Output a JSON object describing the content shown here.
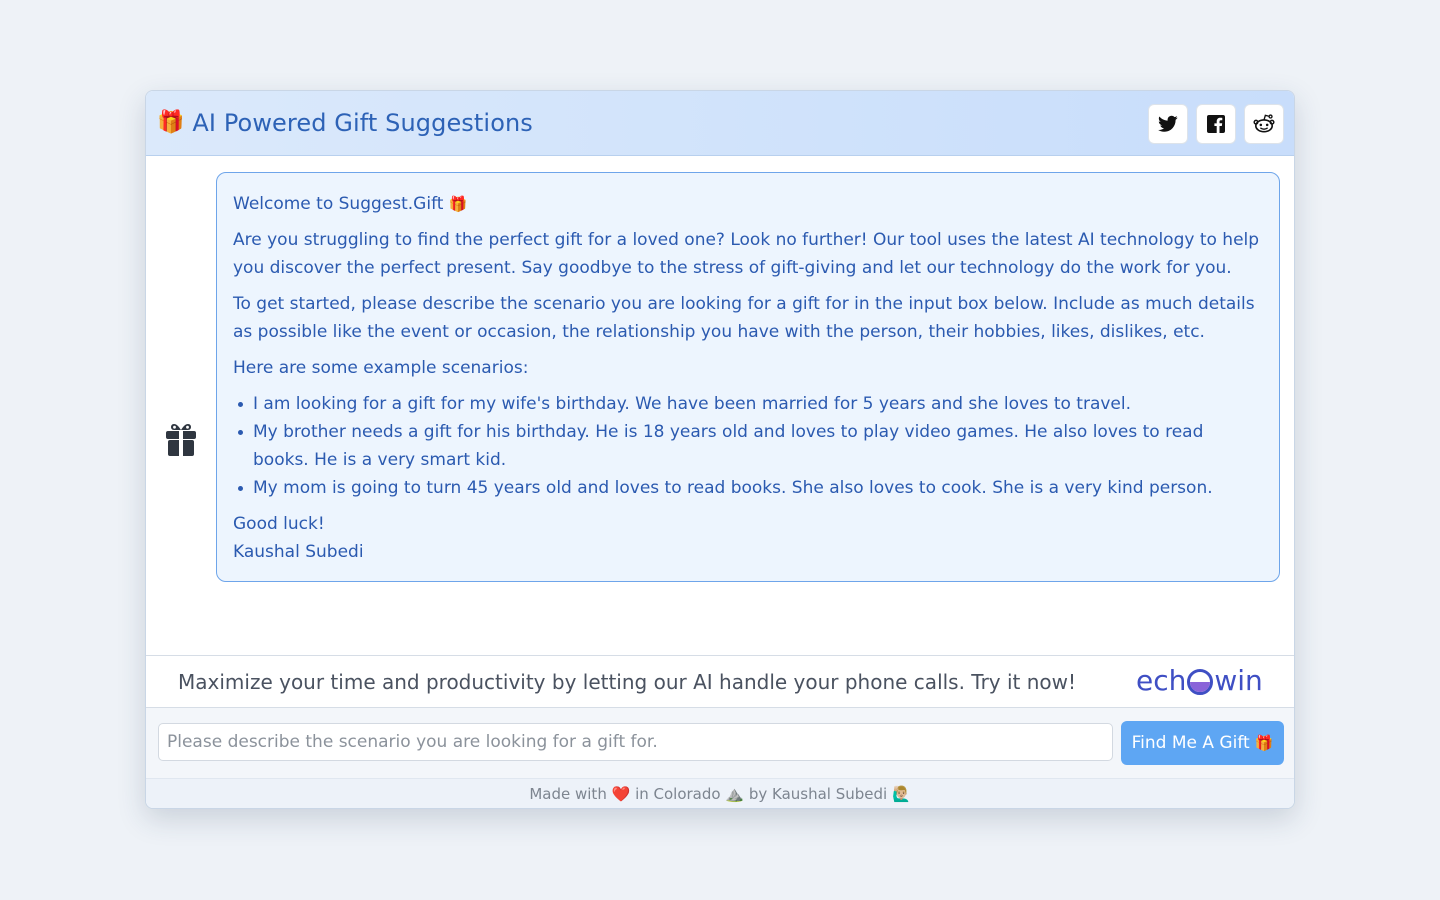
{
  "header": {
    "emoji": "🎁",
    "title": "AI Powered Gift Suggestions",
    "social": [
      {
        "name": "twitter-icon"
      },
      {
        "name": "facebook-icon"
      },
      {
        "name": "reddit-icon"
      }
    ]
  },
  "message": {
    "welcome": "Welcome to Suggest.Gift",
    "welcome_emoji": "🎁",
    "intro": "Are you struggling to find the perfect gift for a loved one? Look no further! Our tool uses the latest AI technology to help you discover the perfect present. Say goodbye to the stress of gift-giving and let our technology do the work for you.",
    "instructions": "To get started, please describe the scenario you are looking for a gift for in the input box below. Include as much details as possible like the event or occasion, the relationship you have with the person, their hobbies, likes, dislikes, etc.",
    "examples_heading": "Here are some example scenarios:",
    "examples": [
      "I am looking for a gift for my wife's birthday. We have been married for 5 years and she loves to travel.",
      "My brother needs a gift for his birthday. He is 18 years old and loves to play video games. He also loves to read books. He is a very smart kid.",
      "My mom is going to turn 45 years old and loves to read books. She also loves to cook. She is a very kind person."
    ],
    "closing": "Good luck!",
    "signature": "Kaushal Subedi"
  },
  "promo": {
    "text": "Maximize your time and productivity by letting our AI handle your phone calls. Try it now!",
    "logo_left": "ech",
    "logo_right": "win"
  },
  "input": {
    "placeholder": "Please describe the scenario you are looking for a gift for.",
    "value": "",
    "button_label": "Find Me A Gift",
    "button_emoji": "🎁"
  },
  "footer": {
    "made_with": "Made with",
    "heart": "❤️",
    "in_place": "in Colorado",
    "mountain": "⛰️",
    "by": "by Kaushal Subedi",
    "person": "🙋🏼‍♂️"
  },
  "colors": {
    "accent": "#2d62b6",
    "bubble_border": "#6ea5ea",
    "button": "#5ea6f3",
    "logo": "#3f4fc4"
  }
}
